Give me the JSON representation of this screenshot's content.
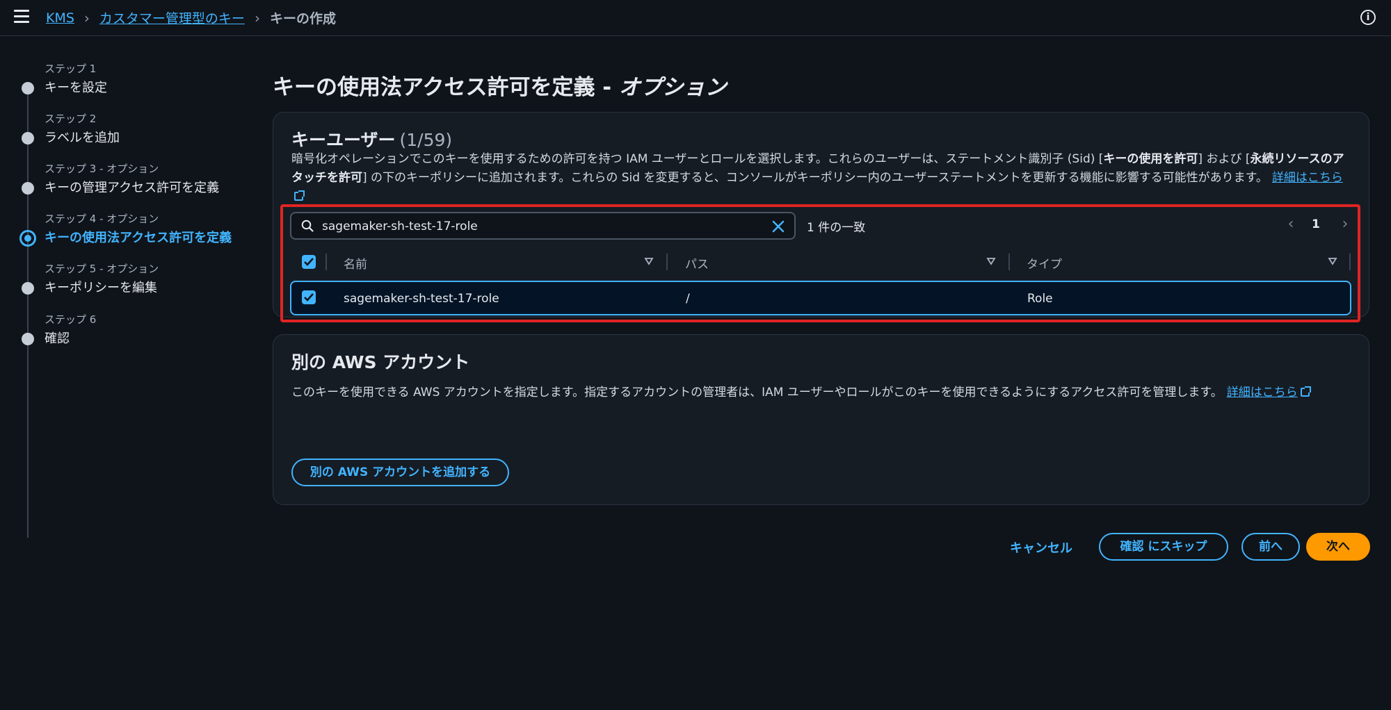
{
  "topbar": {
    "breadcrumb": [
      "KMS",
      "カスタマー管理型のキー"
    ],
    "current": "キーの作成",
    "info_icon": "info-icon",
    "menu_icon": "hamburger-icon"
  },
  "steps": [
    {
      "sub": "ステップ 1",
      "title": "キーを設定",
      "active": false
    },
    {
      "sub": "ステップ 2",
      "title": "ラベルを追加",
      "active": false
    },
    {
      "sub": "ステップ 3 - オプション",
      "title": "キーの管理アクセス許可を定義",
      "active": false
    },
    {
      "sub": "ステップ 4 - オプション",
      "title": "キーの使用法アクセス許可を定義",
      "active": true
    },
    {
      "sub": "ステップ 5 - オプション",
      "title": "キーポリシーを編集",
      "active": false
    },
    {
      "sub": "ステップ 6",
      "title": "確認",
      "active": false
    }
  ],
  "page": {
    "title": "キーの使用法アクセス許可を定義 - ",
    "title_opt": "オプション"
  },
  "key_users": {
    "heading": "キーユーザー",
    "count": "(1/59)",
    "desc_1": "暗号化オペレーションでこのキーを使用するための許可を持つ IAM ユーザーとロールを選択します。これらのユーザーは、ステートメント識別子 (Sid) [",
    "desc_b1": "キーの使用を許可",
    "desc_2": "] および [",
    "desc_b2": "永続リソースのアタッチを許可",
    "desc_3": "] の下のキーポリシーに追加されます。これらの Sid を変更すると、コンソールがキーポリシー内のユーザーステートメントを更新する機能に影響する可能性があります。",
    "learn_more": "詳細はこちら",
    "search_value": "sagemaker-sh-test-17-role",
    "match_count": "1 件の一致",
    "page_number": "1",
    "columns": [
      "名前",
      "パス",
      "タイプ"
    ],
    "rows": [
      {
        "name": "sagemaker-sh-test-17-role",
        "path": "/",
        "type": "Role"
      }
    ]
  },
  "other_accounts": {
    "heading": "別の AWS アカウント",
    "desc": "このキーを使用できる AWS アカウントを指定します。指定するアカウントの管理者は、IAM ユーザーやロールがこのキーを使用できるようにするアクセス許可を管理します。",
    "learn_more": "詳細はこちら",
    "add_button": "別の AWS アカウントを追加する"
  },
  "footer": {
    "cancel": "キャンセル",
    "skip": "確認 にスキップ",
    "prev": "前へ",
    "next": "次へ"
  },
  "colors": {
    "accent": "#42b4ff",
    "primary_button": "#ff9900",
    "highlight": "#e02424",
    "background": "#0f141a"
  }
}
